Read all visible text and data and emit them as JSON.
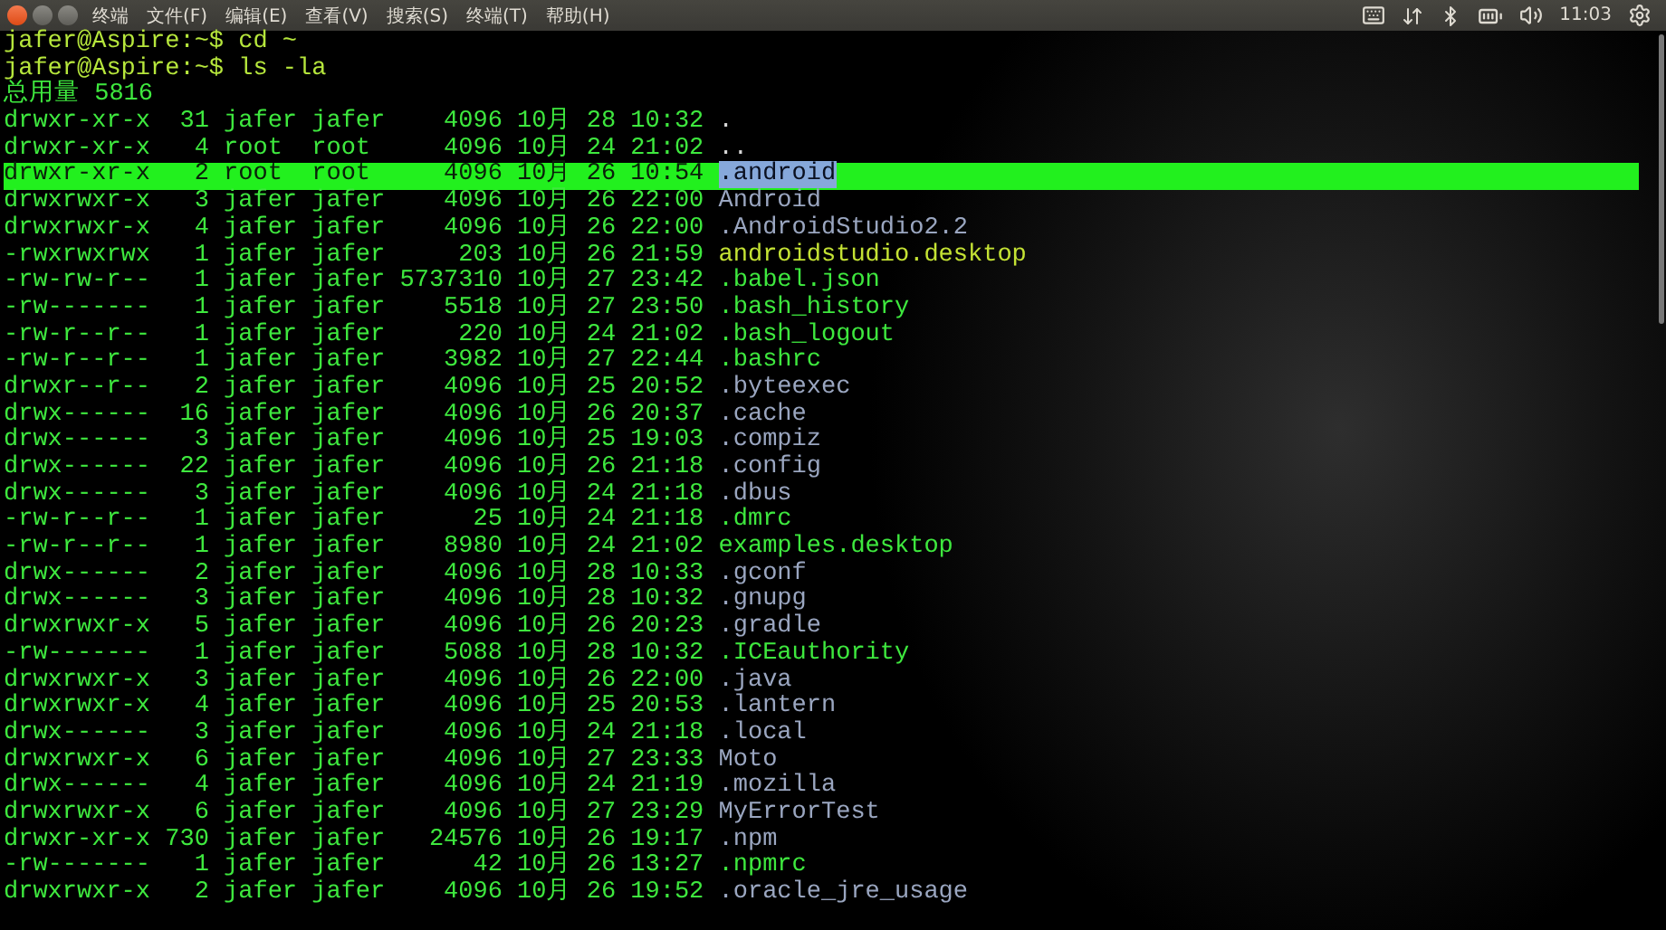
{
  "top_bar": {
    "menus": [
      {
        "label": "终端"
      },
      {
        "label": "文件(F)"
      },
      {
        "label": "编辑(E)"
      },
      {
        "label": "查看(V)"
      },
      {
        "label": "搜索(S)"
      },
      {
        "label": "终端(T)"
      },
      {
        "label": "帮助(H)"
      }
    ],
    "time": "11:03"
  },
  "terminal": {
    "lines": [
      {
        "kind": "prompt",
        "text": "jafer@Aspire:~$ cd ~"
      },
      {
        "kind": "prompt",
        "text": "jafer@Aspire:~$ ls -la"
      },
      {
        "kind": "output",
        "text": "总用量 5816"
      },
      {
        "kind": "entry",
        "info": "drwxr-xr-x  31 jafer jafer    4096 10月 28 10:32",
        "name": ".",
        "color": "#d8d8d8",
        "selected": false
      },
      {
        "kind": "entry",
        "info": "drwxr-xr-x   4 root  root     4096 10月 24 21:02",
        "name": "..",
        "color": "#d8d8d8",
        "selected": false
      },
      {
        "kind": "entry",
        "info": "drwxr-xr-x   2 root  root     4096 10月 26 10:54",
        "name": ".android",
        "color": "#86a8da",
        "selected": true
      },
      {
        "kind": "entry",
        "info": "drwxrwxr-x   3 jafer jafer    4096 10月 26 22:00",
        "name": "Android",
        "color": "#9aa6c0",
        "selected": false
      },
      {
        "kind": "entry",
        "info": "drwxrwxr-x   4 jafer jafer    4096 10月 26 22:00",
        "name": ".AndroidStudio2.2",
        "color": "#9aa6c0",
        "selected": false
      },
      {
        "kind": "entry",
        "info": "-rwxrwxrwx   1 jafer jafer     203 10月 26 21:59",
        "name": "androidstudio.desktop",
        "color": "#c4e234",
        "selected": false
      },
      {
        "kind": "entry",
        "info": "-rw-rw-r--   1 jafer jafer 5737310 10月 27 23:42",
        "name": ".babel.json",
        "color": "#3ee83e",
        "selected": false
      },
      {
        "kind": "entry",
        "info": "-rw-------   1 jafer jafer    5518 10月 27 23:50",
        "name": ".bash_history",
        "color": "#3ee83e",
        "selected": false
      },
      {
        "kind": "entry",
        "info": "-rw-r--r--   1 jafer jafer     220 10月 24 21:02",
        "name": ".bash_logout",
        "color": "#3ee83e",
        "selected": false
      },
      {
        "kind": "entry",
        "info": "-rw-r--r--   1 jafer jafer    3982 10月 27 22:44",
        "name": ".bashrc",
        "color": "#3ee83e",
        "selected": false
      },
      {
        "kind": "entry",
        "info": "drwxr--r--   2 jafer jafer    4096 10月 25 20:52",
        "name": ".byteexec",
        "color": "#9aa6c0",
        "selected": false
      },
      {
        "kind": "entry",
        "info": "drwx------  16 jafer jafer    4096 10月 26 20:37",
        "name": ".cache",
        "color": "#9aa6c0",
        "selected": false
      },
      {
        "kind": "entry",
        "info": "drwx------   3 jafer jafer    4096 10月 25 19:03",
        "name": ".compiz",
        "color": "#9aa6c0",
        "selected": false
      },
      {
        "kind": "entry",
        "info": "drwx------  22 jafer jafer    4096 10月 26 21:18",
        "name": ".config",
        "color": "#9aa6c0",
        "selected": false
      },
      {
        "kind": "entry",
        "info": "drwx------   3 jafer jafer    4096 10月 24 21:18",
        "name": ".dbus",
        "color": "#9aa6c0",
        "selected": false
      },
      {
        "kind": "entry",
        "info": "-rw-r--r--   1 jafer jafer      25 10月 24 21:18",
        "name": ".dmrc",
        "color": "#3ee83e",
        "selected": false
      },
      {
        "kind": "entry",
        "info": "-rw-r--r--   1 jafer jafer    8980 10月 24 21:02",
        "name": "examples.desktop",
        "color": "#3ee83e",
        "selected": false
      },
      {
        "kind": "entry",
        "info": "drwx------   2 jafer jafer    4096 10月 28 10:33",
        "name": ".gconf",
        "color": "#9aa6c0",
        "selected": false
      },
      {
        "kind": "entry",
        "info": "drwx------   3 jafer jafer    4096 10月 28 10:32",
        "name": ".gnupg",
        "color": "#9aa6c0",
        "selected": false
      },
      {
        "kind": "entry",
        "info": "drwxrwxr-x   5 jafer jafer    4096 10月 26 20:23",
        "name": ".gradle",
        "color": "#9aa6c0",
        "selected": false
      },
      {
        "kind": "entry",
        "info": "-rw-------   1 jafer jafer    5088 10月 28 10:32",
        "name": ".ICEauthority",
        "color": "#3ee83e",
        "selected": false
      },
      {
        "kind": "entry",
        "info": "drwxrwxr-x   3 jafer jafer    4096 10月 26 22:00",
        "name": ".java",
        "color": "#9aa6c0",
        "selected": false
      },
      {
        "kind": "entry",
        "info": "drwxrwxr-x   4 jafer jafer    4096 10月 25 20:53",
        "name": ".lantern",
        "color": "#9aa6c0",
        "selected": false
      },
      {
        "kind": "entry",
        "info": "drwx------   3 jafer jafer    4096 10月 24 21:18",
        "name": ".local",
        "color": "#9aa6c0",
        "selected": false
      },
      {
        "kind": "entry",
        "info": "drwxrwxr-x   6 jafer jafer    4096 10月 27 23:33",
        "name": "Moto",
        "color": "#9aa6c0",
        "selected": false
      },
      {
        "kind": "entry",
        "info": "drwx------   4 jafer jafer    4096 10月 24 21:19",
        "name": ".mozilla",
        "color": "#9aa6c0",
        "selected": false
      },
      {
        "kind": "entry",
        "info": "drwxrwxr-x   6 jafer jafer    4096 10月 27 23:29",
        "name": "MyErrorTest",
        "color": "#9aa6c0",
        "selected": false
      },
      {
        "kind": "entry",
        "info": "drwxr-xr-x 730 jafer jafer   24576 10月 26 19:17",
        "name": ".npm",
        "color": "#9aa6c0",
        "selected": false
      },
      {
        "kind": "entry",
        "info": "-rw-------   1 jafer jafer      42 10月 26 13:27",
        "name": ".npmrc",
        "color": "#3ee83e",
        "selected": false
      },
      {
        "kind": "entry",
        "info": "drwxrwxr-x   2 jafer jafer    4096 10月 26 19:52",
        "name": ".oracle_jre_usage",
        "color": "#9aa6c0",
        "selected": false
      }
    ]
  }
}
